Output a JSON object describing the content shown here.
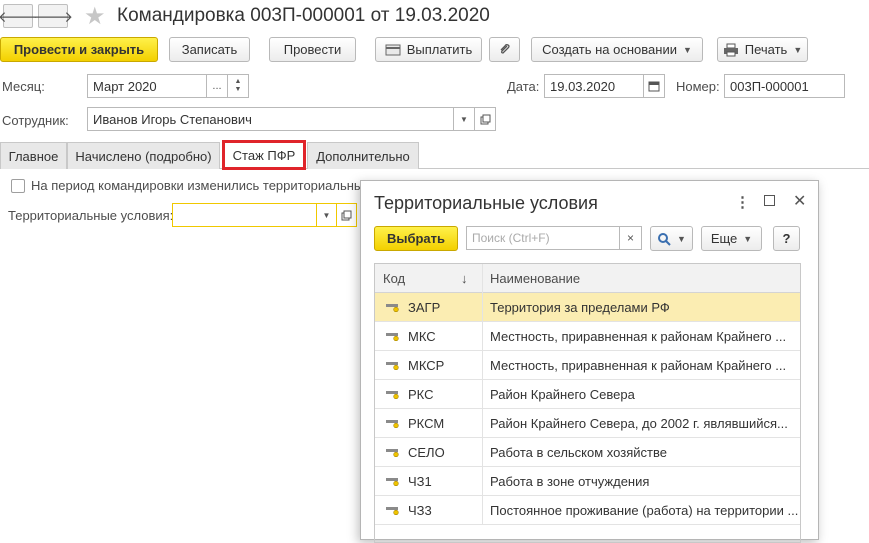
{
  "header": {
    "title": "Командировка 003П-000001 от 19.03.2020",
    "back_glyph": "🡐",
    "forward_glyph": "🡒",
    "star_glyph": "★"
  },
  "toolbar": {
    "post_close": "Провести и закрыть",
    "save": "Записать",
    "post": "Провести",
    "pay": "Выплатить",
    "create_based": "Создать на основании",
    "print": "Печать"
  },
  "form": {
    "month_label": "Месяц:",
    "month_value": "Март 2020",
    "date_label": "Дата:",
    "date_value": "19.03.2020",
    "number_label": "Номер:",
    "number_value": "003П-000001",
    "employee_label": "Сотрудник:",
    "employee_value": "Иванов Игорь Степанович"
  },
  "tabs": [
    "Главное",
    "Начислено (подробно)",
    "Стаж ПФР",
    "Дополнительно"
  ],
  "pfr": {
    "checkbox_label": "На период командировки изменились территориальные",
    "terr_label": "Территориальные условия:",
    "terr_value": ""
  },
  "popup": {
    "title": "Территориальные условия",
    "select": "Выбрать",
    "search_placeholder": "Поиск (Ctrl+F)",
    "more": "Еще",
    "help": "?",
    "col_code": "Код",
    "col_name": "Наименование",
    "sort_glyph": "↓",
    "rows": [
      {
        "code": "ЗАГР",
        "name": "Территория за пределами РФ"
      },
      {
        "code": "МКС",
        "name": "Местность, приравненная к районам Крайнего ..."
      },
      {
        "code": "МКСР",
        "name": "Местность, приравненная к районам Крайнего ..."
      },
      {
        "code": "РКС",
        "name": "Район Крайнего Севера"
      },
      {
        "code": "РКСМ",
        "name": "Район Крайнего Севера, до 2002 г. являвшийся..."
      },
      {
        "code": "СЕЛО",
        "name": "Работа в сельском хозяйстве"
      },
      {
        "code": "ЧЗ1",
        "name": "Работа в зоне отчуждения"
      },
      {
        "code": "ЧЗ3",
        "name": "Постоянное проживание (работа) на территории ..."
      }
    ]
  },
  "colors": {
    "accent": "#f3d000",
    "tab_highlight": "#e0242a",
    "selected_row": "#fbedb2"
  }
}
